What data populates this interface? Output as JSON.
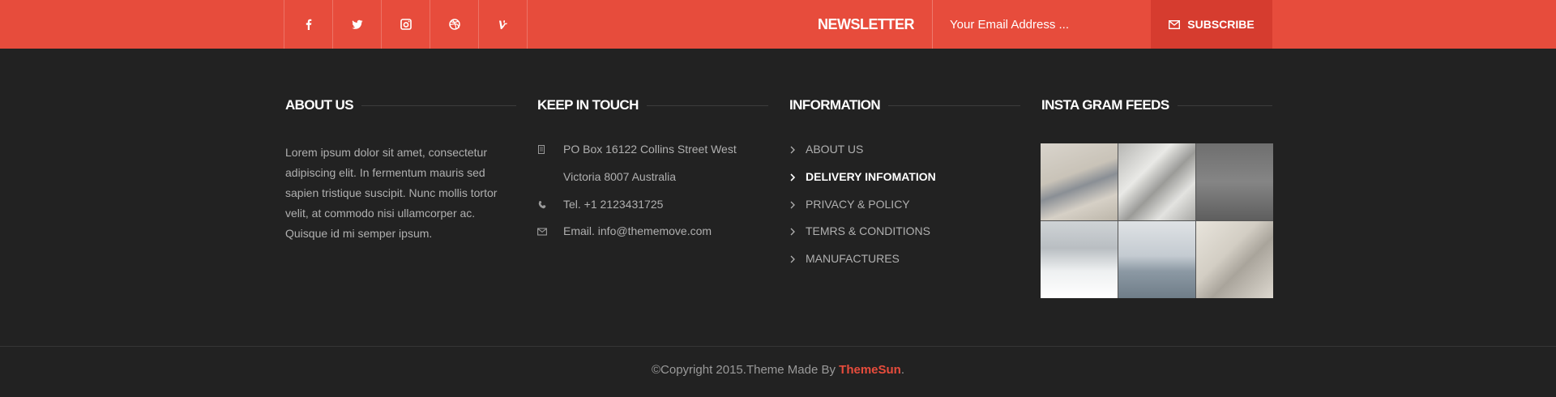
{
  "social": [
    {
      "name": "facebook-icon",
      "glyph": "f"
    },
    {
      "name": "twitter-icon",
      "glyph": "t"
    },
    {
      "name": "instagram-icon",
      "glyph": "i"
    },
    {
      "name": "dribbble-icon",
      "glyph": "d"
    },
    {
      "name": "vine-icon",
      "glyph": "v"
    }
  ],
  "newsletter": {
    "label": "NEWSLETTER",
    "placeholder": "Your Email Address ...",
    "button": "SUBSCRIBE"
  },
  "about": {
    "title": "ABOUT US",
    "text": "Lorem ipsum dolor sit amet, consectetur adipiscing elit. In fermentum mauris sed sapien tristique suscipit. Nunc mollis tortor velit, at commodo nisi ullamcorper ac. Quisque id mi semper ipsum."
  },
  "contact": {
    "title": "KEEP IN TOUCH",
    "address_line1": "PO Box 16122 Collins Street West",
    "address_line2": "Victoria 8007 Australia",
    "phone": "Tel. +1 2123431725",
    "email": "Email. info@thememove.com"
  },
  "information": {
    "title": "INFORMATION",
    "items": [
      "ABOUT US",
      "DELIVERY INFOMATION",
      "PRIVACY & POLICY",
      "TEMRS & CONDITIONS",
      "MANUFACTURES"
    ],
    "active_index": 1
  },
  "instagram": {
    "title": "INSTA GRAM FEEDS"
  },
  "footer": {
    "copyright_prefix": "©Copyright 2015.Theme Made By ",
    "brand": "ThemeSun",
    "suffix": "."
  },
  "colors": {
    "accent": "#e74c3c",
    "subscribe_bg": "#d63c2f",
    "background": "#222222"
  }
}
